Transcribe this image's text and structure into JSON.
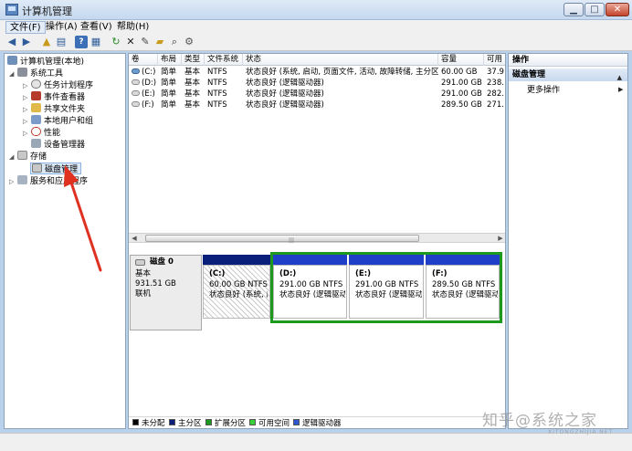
{
  "window": {
    "title": "计算机管理",
    "controls": {
      "minimize": "▁",
      "maximize": "□",
      "close": "✕"
    }
  },
  "menu": [
    "文件(F)",
    "操作(A)",
    "查看(V)",
    "帮助(H)"
  ],
  "toolbar_icons": [
    "back-arrow-icon",
    "forward-arrow-icon",
    "up-folder-icon",
    "show-tree-icon",
    "help-icon",
    "properties-icon",
    "refresh-icon",
    "delete-icon",
    "rename-icon",
    "open-folder-icon",
    "search-icon",
    "settings-icon"
  ],
  "tree": {
    "root": "计算机管理(本地)",
    "system_tools": "系统工具",
    "task_scheduler": "任务计划程序",
    "event_viewer": "事件查看器",
    "shared_folders": "共享文件夹",
    "local_users": "本地用户和组",
    "performance": "性能",
    "device_manager": "设备管理器",
    "storage": "存储",
    "disk_management": "磁盘管理",
    "services": "服务和应用程序"
  },
  "volume_table": {
    "columns": [
      "卷",
      "布局",
      "类型",
      "文件系统",
      "状态",
      "容量",
      "可用"
    ],
    "rows": [
      [
        "(C:)",
        "简单",
        "基本",
        "NTFS",
        "状态良好 (系统, 启动, 页面文件, 活动, 故障转储, 主分区)",
        "60.00 GB",
        "37.9"
      ],
      [
        "(D:)",
        "简单",
        "基本",
        "NTFS",
        "状态良好 (逻辑驱动器)",
        "291.00 GB",
        "238."
      ],
      [
        "(E:)",
        "简单",
        "基本",
        "NTFS",
        "状态良好 (逻辑驱动器)",
        "291.00 GB",
        "282."
      ],
      [
        "(F:)",
        "简单",
        "基本",
        "NTFS",
        "状态良好 (逻辑驱动器)",
        "289.50 GB",
        "271."
      ]
    ]
  },
  "disk": {
    "name": "磁盘 0",
    "type": "基本",
    "size": "931.51 GB",
    "status": "联机",
    "partitions": [
      {
        "letter": "(C:)",
        "size": "60.00 GB NTFS",
        "status": "状态良好 (系统, 启"
      },
      {
        "letter": "(D:)",
        "size": "291.00 GB NTFS",
        "status": "状态良好 (逻辑驱动"
      },
      {
        "letter": "(E:)",
        "size": "291.00 GB NTFS",
        "status": "状态良好 (逻辑驱动"
      },
      {
        "letter": "(F:)",
        "size": "289.50 GB NTFS",
        "status": "状态良好 (逻辑驱动"
      }
    ]
  },
  "legend": [
    {
      "label": "未分配",
      "color": "#000000"
    },
    {
      "label": "主分区",
      "color": "#1f3d8f"
    },
    {
      "label": "扩展分区",
      "color": "#1d9a1d"
    },
    {
      "label": "可用空间",
      "color": "#39d039"
    },
    {
      "label": "逻辑驱动器",
      "color": "#2b57d0"
    }
  ],
  "actions": {
    "header": "操作",
    "section": "磁盘管理",
    "more": "更多操作"
  },
  "colors": {
    "primary_bar": "#0a1f7a",
    "logical_bar": "#1f3fc9",
    "extended_frame": "#1d9a1d",
    "annotation": "#e03020"
  },
  "watermark": {
    "text": "知乎@系统之家",
    "url": "XITONGZHIJIA.NET"
  }
}
